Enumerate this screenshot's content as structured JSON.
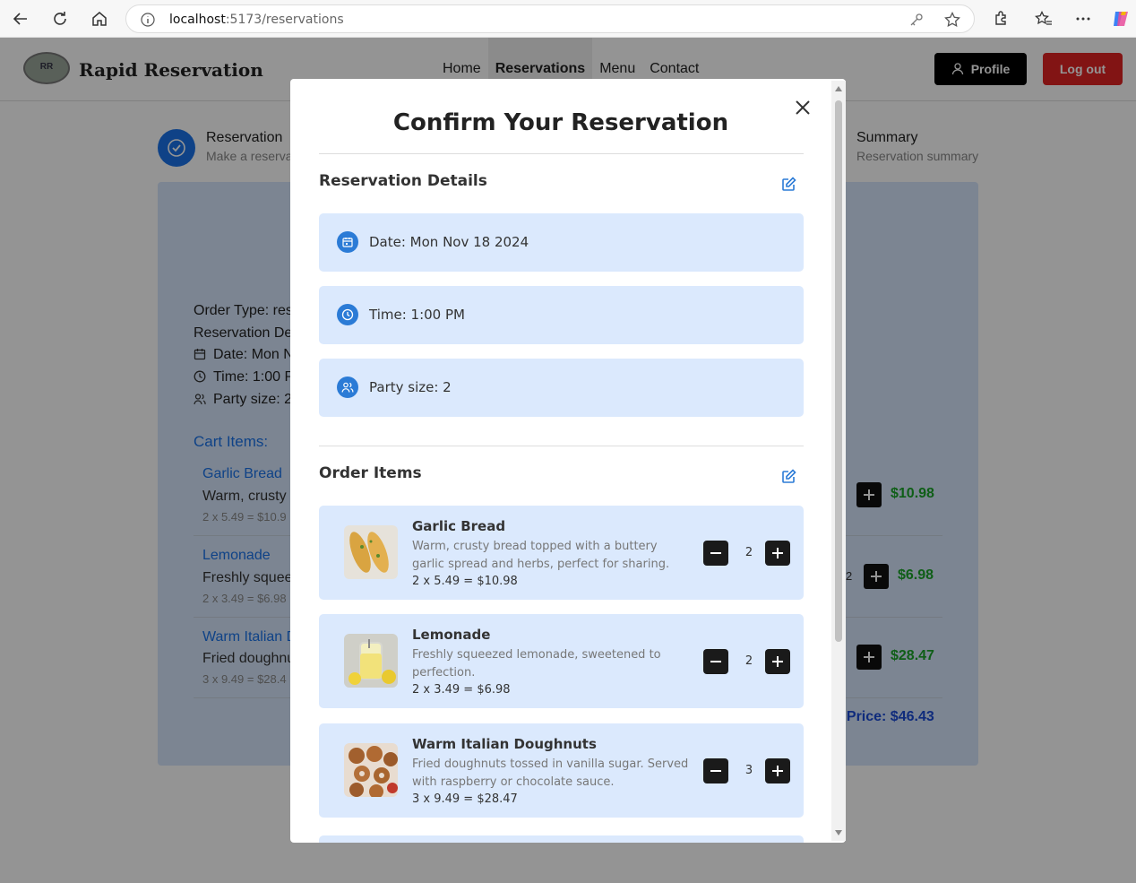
{
  "browser": {
    "url_host": "localhost",
    "url_path": ":5173/reservations"
  },
  "site": {
    "brand": "Rapid Reservation",
    "logo_text": "RR",
    "nav": [
      "Home",
      "Reservations",
      "Menu",
      "Contact"
    ],
    "active_nav": "Reservations",
    "profile_label": "Profile",
    "logout_label": "Log out"
  },
  "steps": {
    "first_title": "Reservation",
    "first_sub": "Make a reserva",
    "last_title": "Summary",
    "last_sub": "Reservation summary"
  },
  "background_summary": {
    "order_type": "Order Type: res",
    "reservation_details": "Reservation De",
    "date": "Date: Mon N",
    "time": "Time: 1:00 P",
    "party": "Party size: 2",
    "cart_title": "Cart Items:",
    "items": [
      {
        "name": "Garlic Bread",
        "desc": "Warm, crusty",
        "calc": "2 x 5.49 = $10.9",
        "price": "$10.98"
      },
      {
        "name": "Lemonade",
        "desc": "Freshly squee",
        "calc": "2 x 3.49 = $6.98",
        "price": "$6.98"
      },
      {
        "name": "Warm Italian D",
        "desc": "Fried doughnu",
        "calc": "3 x 9.49 = $28.4",
        "price": "$28.47"
      }
    ],
    "partial_qty": "2",
    "total": "l Price: $46.43"
  },
  "modal": {
    "title": "Confirm Your Reservation",
    "details_title": "Reservation Details",
    "date": "Date: Mon Nov 18 2024",
    "time": "Time: 1:00 PM",
    "party": "Party size: 2",
    "order_title": "Order Items",
    "items": [
      {
        "name": "Garlic Bread",
        "desc": "Warm, crusty bread topped with a buttery garlic spread and herbs, perfect for sharing.",
        "calc": "2 x 5.49 = $10.98",
        "qty": "2",
        "image_icon": "garlic-bread-photo"
      },
      {
        "name": "Lemonade",
        "desc": "Freshly squeezed lemonade, sweetened to perfection.",
        "calc": "2 x 3.49 = $6.98",
        "qty": "2",
        "image_icon": "lemonade-photo"
      },
      {
        "name": "Warm Italian Doughnuts",
        "desc": "Fried doughnuts tossed in vanilla sugar. Served with raspberry or chocolate sauce.",
        "calc": "3 x 9.49 = $28.47",
        "qty": "3",
        "image_icon": "doughnuts-photo"
      }
    ]
  },
  "colors": {
    "accent_blue": "#2b7bd6",
    "detail_bg": "#dbe9fd",
    "logout_red": "#e02424",
    "price_green": "#1aa329",
    "total_blue": "#1b4bd6"
  }
}
